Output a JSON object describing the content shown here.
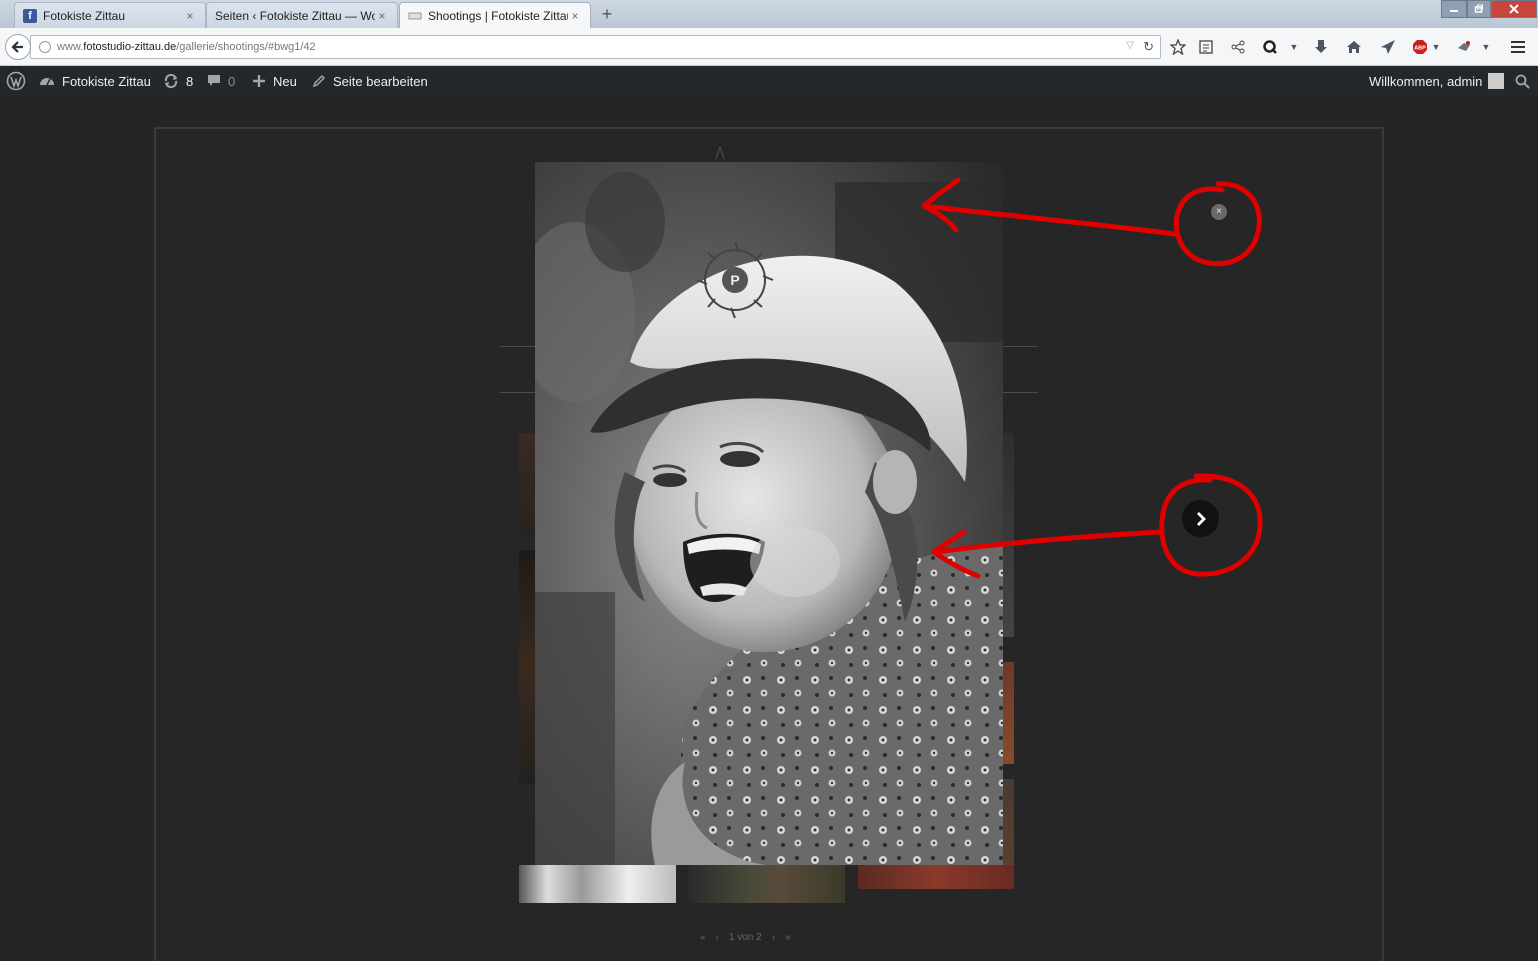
{
  "browser": {
    "tabs": [
      {
        "title": "Fotokiste Zittau",
        "active": false,
        "icon": "facebook-icon"
      },
      {
        "title": "Seiten ‹ Fotokiste Zittau — Wor...",
        "active": false,
        "icon": "none"
      },
      {
        "title": "Shootings | Fotokiste Zittau",
        "active": true,
        "icon": "page-icon"
      }
    ],
    "close_glyph": "×",
    "new_tab_glyph": "+",
    "url": {
      "prefix": "www.",
      "host": "fotostudio-zittau.de",
      "path": "/gallerie/shootings/#bwg1/42"
    },
    "toolbar_icons": [
      "star-icon",
      "reader-icon",
      "share-icon",
      "q-icon",
      "download-icon",
      "home-icon",
      "send-icon",
      "adblock-icon",
      "extension-icon",
      "menu-icon"
    ]
  },
  "adminbar": {
    "site_name": "Fotokiste Zittau",
    "updates_count": "8",
    "comments_count": "0",
    "new_label": "Neu",
    "edit_label": "Seite bearbeiten",
    "welcome": "Willkommen, admin"
  },
  "gallery": {
    "pagination": {
      "first": "«",
      "prev": "‹",
      "label": "1 von 2",
      "next": "›",
      "last": "»"
    }
  },
  "lightbox": {
    "close_glyph": "×",
    "next_glyph": "›"
  },
  "colors": {
    "annotation": "#e00000",
    "page_bg": "#252525",
    "adminbar_bg": "#23282d"
  }
}
